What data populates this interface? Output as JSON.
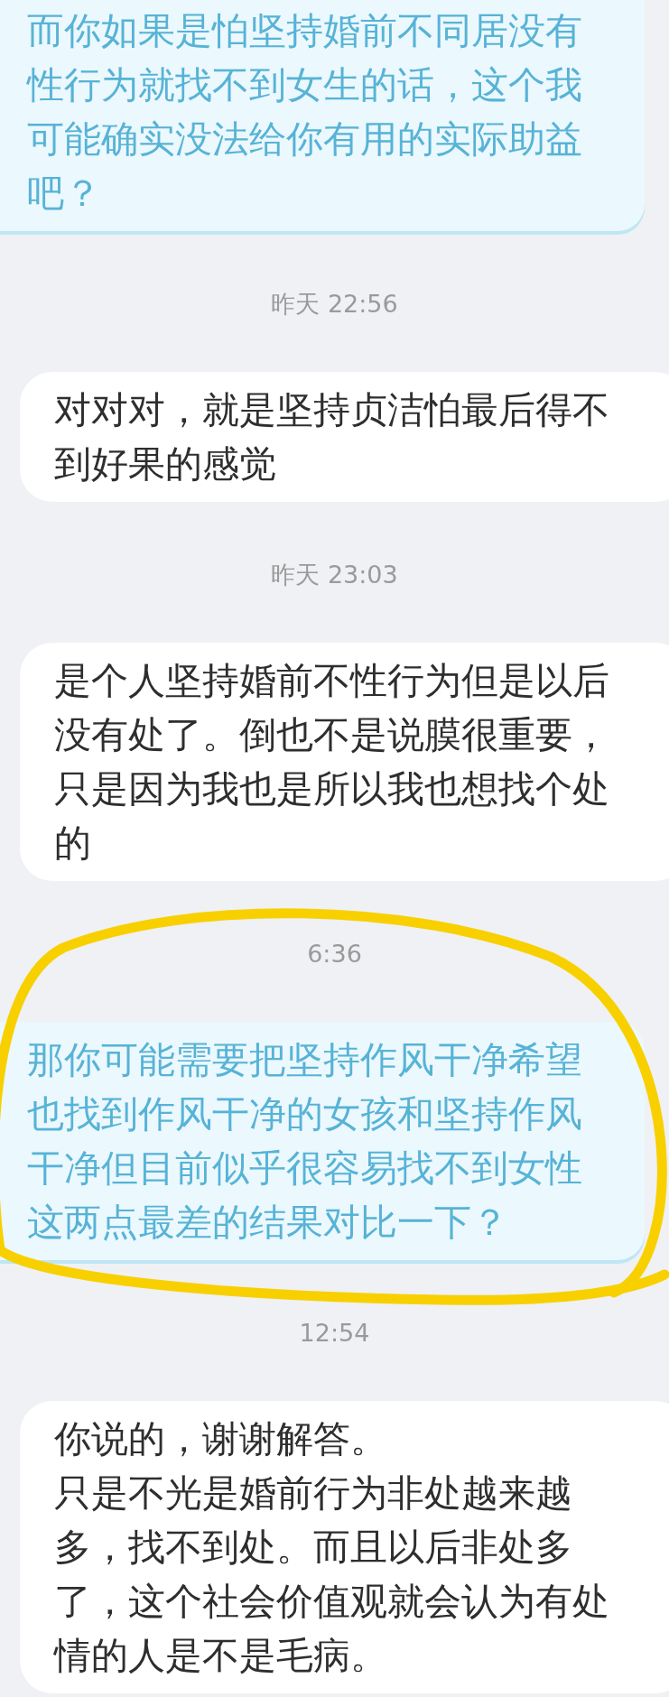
{
  "messages": [
    {
      "kind": "sent",
      "paragraphs": [
        "而你如果是怕坚持婚前不同居没有性行为就找不到女生的话，这个我可能确实没法给你有用的实际助益吧？"
      ]
    },
    {
      "kind": "timestamp",
      "text": "昨天 22:56"
    },
    {
      "kind": "received",
      "paragraphs": [
        "对对对，就是坚持贞洁怕最后得不到好果的感觉"
      ]
    },
    {
      "kind": "timestamp",
      "text": "昨天 23:03"
    },
    {
      "kind": "received",
      "paragraphs": [
        "是个人坚持婚前不性行为但是以后没有处了。倒也不是说膜很重要，只是因为我也是所以我也想找个处的"
      ]
    },
    {
      "kind": "timestamp",
      "text": "6:36"
    },
    {
      "kind": "sent",
      "paragraphs": [
        "那你可能需要把坚持作风干净希望也找到作风干净的女孩和坚持作风干净但目前似乎很容易找不到女性这两点最差的结果对比一下？"
      ]
    },
    {
      "kind": "timestamp",
      "text": "12:54"
    },
    {
      "kind": "received",
      "paragraphs": [
        "你说的，谢谢解答。",
        "只是不光是婚前行为非处越来越多，找不到处。而且以后非处多了，这个社会价值观就会认为有处情的人是不是毛病。"
      ]
    }
  ]
}
